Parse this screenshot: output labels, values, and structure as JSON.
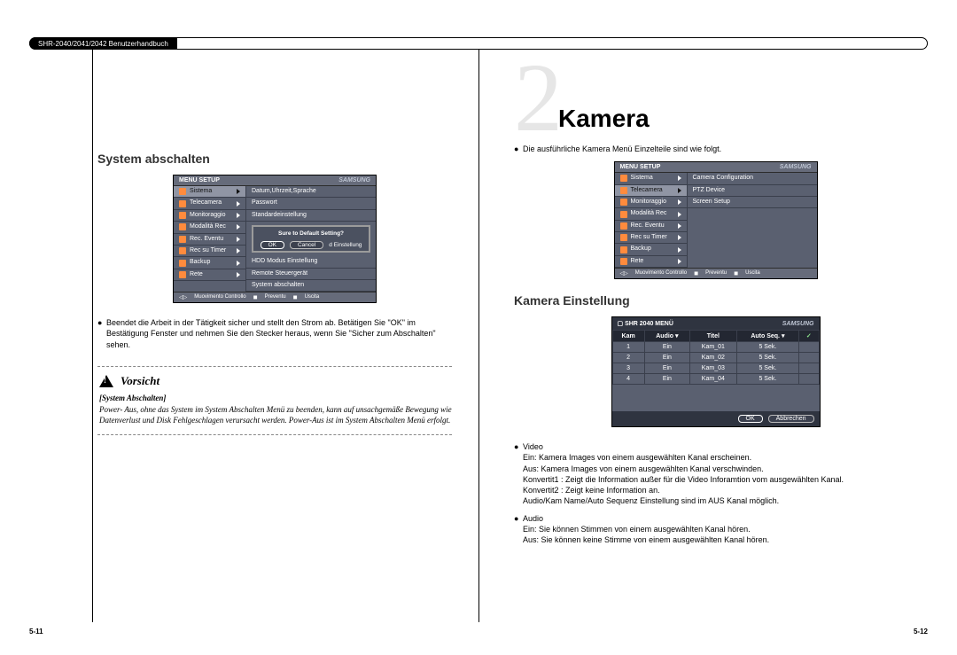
{
  "header": {
    "chip": "SHR-2040/2041/2042 Benutzerhandbuch"
  },
  "pageNumbers": {
    "left": "5-11",
    "right": "5-12"
  },
  "left": {
    "section_title": "System abschalten",
    "bullet1": "Beendet die Arbeit in der Tätigkeit sicher und stellt den Strom ab. Betätigen Sie \"OK\" im Bestätigung Fenster und nehmen Sie den Stecker heraus, wenn Sie \"Sicher zum Abschalten\" sehen.",
    "caution": {
      "label": "Vorsicht",
      "sub": "[System Abschalten]",
      "body": "Power- Aus, ohne das System im System Abschalten Menü zu beenden, kann auf unsachgemäße Bewegung wie Datenverlust und Disk Fehlgeschlagen verursacht werden. Power-Aus ist im System Abschalten Menü erfolgt."
    },
    "osd": {
      "title": "MENU SETUP",
      "brand": "SAMSUNG",
      "left_items": [
        "Sistema",
        "Telecamera",
        "Monitoraggio",
        "Modalità Rec",
        "Rec. Eventu",
        "Rec su Timer",
        "Backup",
        "Rete"
      ],
      "right_items": [
        "Datum,Uhrzeit,Sprache",
        "Passwort",
        "Standardeinstellung",
        "HDD Modus Einstellung",
        "Remote Steuergerät",
        "System abschalten"
      ],
      "modal_title": "Sure to Default Setting?",
      "modal_ok": "OK",
      "modal_cancel": "Cancel",
      "modal_right_tail": "d Einstellung",
      "foot": [
        "Muovimento Controllo",
        "Preventu",
        "Uscita"
      ]
    }
  },
  "right": {
    "chapter_num": "2",
    "chapter_title": "Kamera",
    "intro_bullet": "Die ausführliche Kamera Menü Einzelteile sind wie folgt.",
    "osd": {
      "title": "MENU SETUP",
      "brand": "SAMSUNG",
      "left_items": [
        "Sistema",
        "Telecamera",
        "Monitoraggio",
        "Modalità Rec",
        "Rec. Eventu",
        "Rec su Timer",
        "Backup",
        "Rete"
      ],
      "right_items": [
        "Camera Configuration",
        "PTZ Device",
        "Screen Setup"
      ],
      "foot": [
        "Muovimento Controllo",
        "Preventu",
        "Uscita"
      ]
    },
    "section_title": "Kamera Einstellung",
    "osd2": {
      "title": "SHR 2040 MENÜ",
      "brand": "SAMSUNG",
      "headers": [
        "Kam",
        "Audio ▾",
        "Titel",
        "Auto Seq. ▾"
      ],
      "rows": [
        [
          "1",
          "Ein",
          "Kam_01",
          "5 Sek."
        ],
        [
          "2",
          "Ein",
          "Kam_02",
          "5 Sek."
        ],
        [
          "3",
          "Ein",
          "Kam_03",
          "5 Sek."
        ],
        [
          "4",
          "Ein",
          "Kam_04",
          "5 Sek."
        ]
      ],
      "ok": "OK",
      "cancel": "Abbrechen"
    },
    "video": {
      "label": "Video",
      "body": "Ein: Kamera Images von einem ausgewählten Kanal erscheinen.\nAus: Kamera Images von einem ausgewählten Kanal verschwinden.\nKonvertit1 : Zeigt die Information außer für die Video Inforamtion vom ausgewählten Kanal.\nKonvertit2 : Zeigt keine Information an.\nAudio/Kam Name/Auto Sequenz Einstellung sind im AUS Kanal möglich."
    },
    "audio": {
      "label": "Audio",
      "body": "Ein: Sie können Stimmen von einem ausgewählten Kanal hören.\nAus: Sie können keine Stimme von einem ausgewählten Kanal hören."
    }
  }
}
